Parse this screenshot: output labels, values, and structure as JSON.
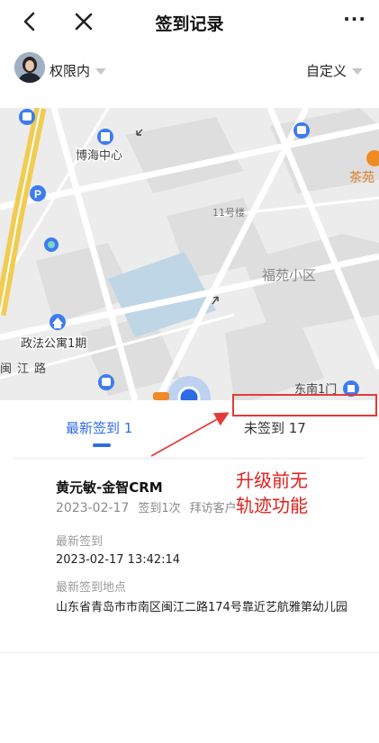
{
  "header": {
    "title": "签到记录",
    "more_label": "···"
  },
  "filter": {
    "permission_label": "权限内",
    "range_label": "自定义"
  },
  "map": {
    "labels": {
      "bohai": "博海中心",
      "building11": "11号楼",
      "fuyuan": "福苑小区",
      "zhengfa": "政法公寓1期",
      "road": "闽江路",
      "dongnan": "东南1门",
      "tea": "茶苑"
    }
  },
  "tabs": {
    "latest": "最新签到 1",
    "unsigned": "未签到 17"
  },
  "annotation": {
    "text": "升级前无\n轨迹功能"
  },
  "record": {
    "name": "黄元敏-金智CRM",
    "date": "2023-02-17",
    "count": "签到1次",
    "visit": "拜访客户",
    "latest_label": "最新签到",
    "latest_time": "2023-02-17 13:42:14",
    "location_label": "最新签到地点",
    "address": "山东省青岛市市南区闽江二路174号靠近艺航雅第幼儿园"
  },
  "colors": {
    "accent": "#2e6be6",
    "annotation": "#e53935"
  }
}
